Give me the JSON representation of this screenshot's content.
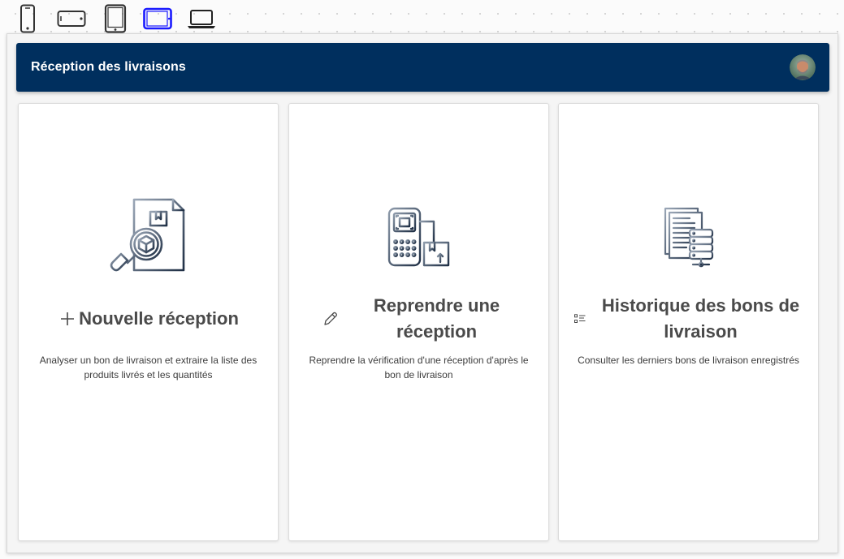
{
  "device_switcher": {
    "devices": [
      {
        "name": "phone-portrait",
        "icon": "mobile-portrait-icon",
        "active": false
      },
      {
        "name": "phone-landscape",
        "icon": "mobile-landscape-icon",
        "active": false
      },
      {
        "name": "tablet-portrait",
        "icon": "tablet-portrait-icon",
        "active": false
      },
      {
        "name": "tablet-landscape",
        "icon": "tablet-landscape-icon",
        "active": true
      },
      {
        "name": "laptop",
        "icon": "laptop-icon",
        "active": false
      }
    ],
    "active_color": "#1a1aff"
  },
  "header": {
    "title": "Réception des livraisons",
    "background_color": "#002f5e",
    "avatar_icon": "user-avatar-icon"
  },
  "cards": [
    {
      "illustration": "document-search-package-icon",
      "action_icon": "plus-icon",
      "title": "Nouvelle réception",
      "description": "Analyser un bon de livraison et extraire la liste des produits livrés et les quantités"
    },
    {
      "illustration": "barcode-scanner-package-icon",
      "action_icon": "pencil-icon",
      "title": "Reprendre une réception",
      "description": "Reprendre la vérification d'une réception d'après le bon de livraison"
    },
    {
      "illustration": "documents-database-icon",
      "action_icon": "list-icon",
      "title": "Historique des bons de livraison",
      "description": "Consulter les derniers bons de livraison enregistrés"
    }
  ]
}
